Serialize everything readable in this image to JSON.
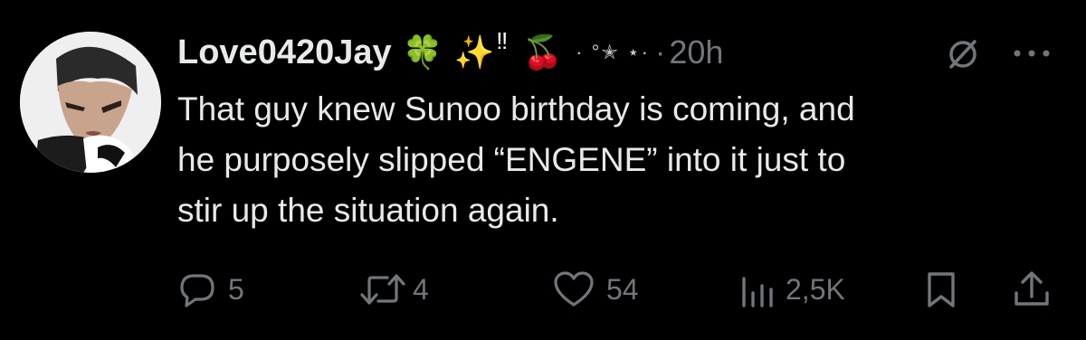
{
  "post": {
    "author": {
      "display_name": "Love0420Jay",
      "name_emojis": [
        "🍀",
        "✨",
        "‼",
        "🍒"
      ],
      "decoration": "· °✭ ⋆·"
    },
    "time_separator": "·",
    "timestamp": "20h",
    "text_lines": [
      "That guy knew Sunoo birthday is coming, and",
      "he purposely slipped “ENGENE” into it just to",
      "stir up the situation again."
    ]
  },
  "actions": {
    "reply": {
      "icon": "reply-bubble-icon",
      "count": "5"
    },
    "repost": {
      "icon": "repost-arrows-icon",
      "count": "4"
    },
    "like": {
      "icon": "heart-icon",
      "count": "54"
    },
    "views": {
      "icon": "views-bars-icon",
      "count": "2,5K"
    },
    "bookmark": {
      "icon": "bookmark-icon"
    },
    "share": {
      "icon": "share-upload-icon"
    }
  },
  "header_icons": {
    "grok": "grok-slash-circle-icon",
    "more": "more-dots-icon"
  },
  "colors": {
    "background": "#000000",
    "primary_text": "#e7e9ea",
    "secondary_text": "#71767b"
  }
}
